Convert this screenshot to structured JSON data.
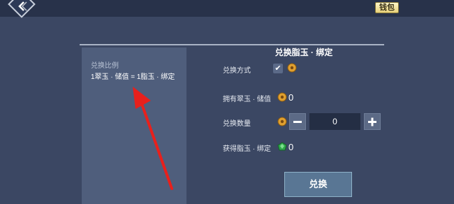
{
  "topbar": {
    "back_icon": "chevron-left-icon",
    "wallet_label": "钱包"
  },
  "ratio_panel": {
    "title": "兑换比例",
    "text": "1翠玉 · 储值 = 1脂玉 · 绑定"
  },
  "exchange_panel": {
    "title": "兑换脂玉 · 绑定",
    "rows": {
      "method": {
        "label": "兑换方式",
        "checked": true,
        "icon": "gold-coin-icon"
      },
      "owned": {
        "label": "拥有翠玉 · 储值",
        "icon": "gold-coin-icon",
        "value": "0"
      },
      "quantity": {
        "label": "兑换数量",
        "icon": "gold-coin-icon",
        "value": "0",
        "minus_icon": "minus-icon",
        "plus_icon": "plus-icon"
      },
      "obtained": {
        "label": "获得脂玉 · 绑定",
        "icon": "green-gem-icon",
        "value": "0"
      }
    },
    "submit_label": "兑换"
  },
  "colors": {
    "background": "#3b4763",
    "left_panel": "#4f5e7c",
    "button": "#597694",
    "annotation_arrow": "#e8201c",
    "coin_gold": "#e0a030",
    "gem_green": "#2fa84a"
  }
}
